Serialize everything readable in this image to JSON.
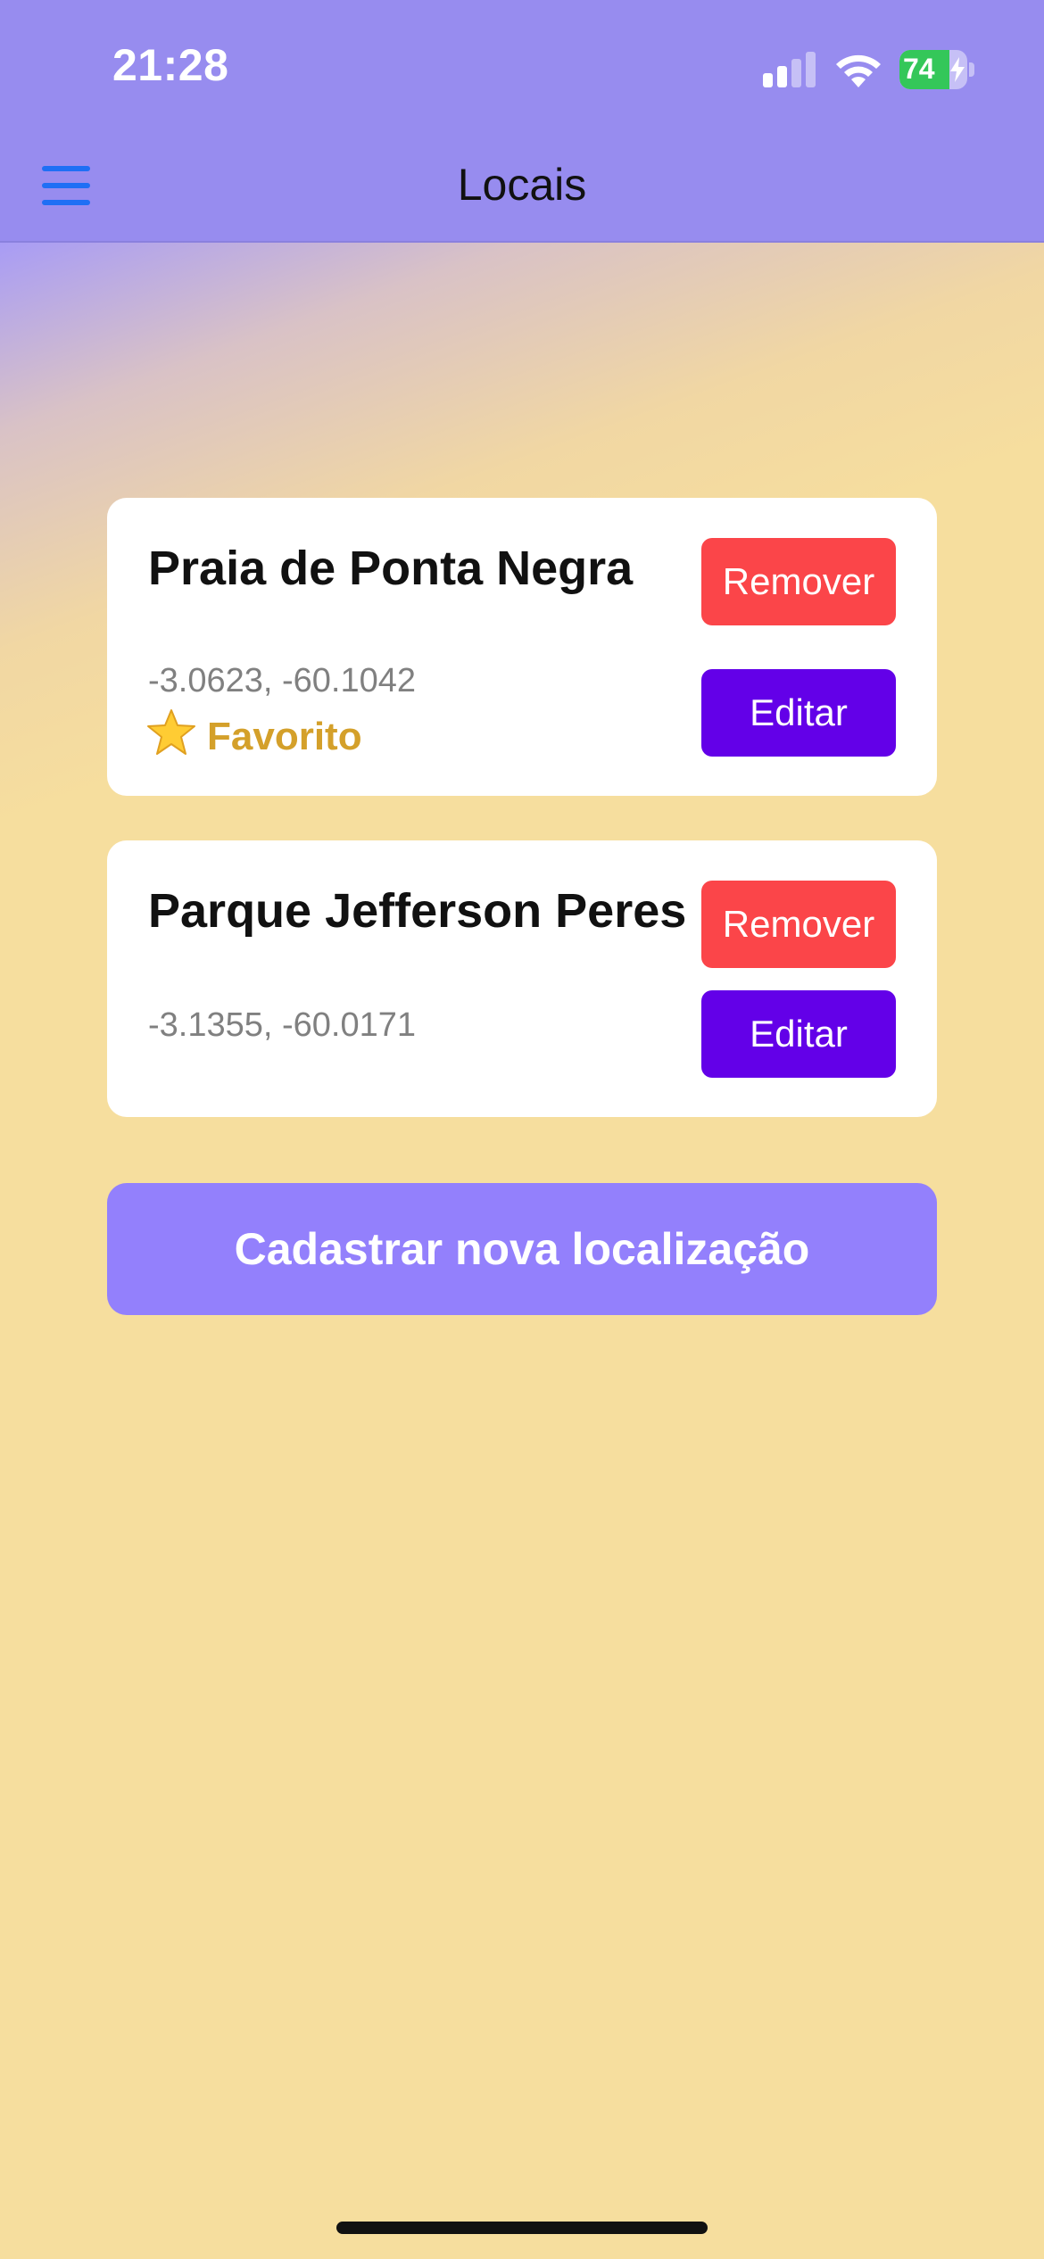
{
  "status_bar": {
    "time": "21:28",
    "battery_level": "74",
    "battery_fraction": 0.74,
    "signal_bars_active": 2,
    "signal_bars_total": 4,
    "charging": true
  },
  "nav": {
    "title": "Locais",
    "menu_icon": "hamburger-menu-icon"
  },
  "locations": [
    {
      "name": "Praia de Ponta Negra",
      "coords": "-3.0623, -60.1042",
      "favorite_label": "Favorito",
      "favorite_icon": "star-icon",
      "remove_label": "Remover",
      "edit_label": "Editar"
    },
    {
      "name": "Parque Jefferson Peres",
      "coords": "-3.1355, -60.0171",
      "remove_label": "Remover",
      "edit_label": "Editar"
    }
  ],
  "actions": {
    "add_location_label": "Cadastrar nova localização"
  },
  "colors": {
    "header": "#978cef",
    "background": "#f6de9e",
    "remove_button": "#fb4549",
    "edit_button": "#6300e8",
    "primary_button": "#9380fc",
    "favorite_text": "#d4a02a",
    "menu_icon": "#1f6ff5",
    "battery_fill": "#34c759"
  }
}
